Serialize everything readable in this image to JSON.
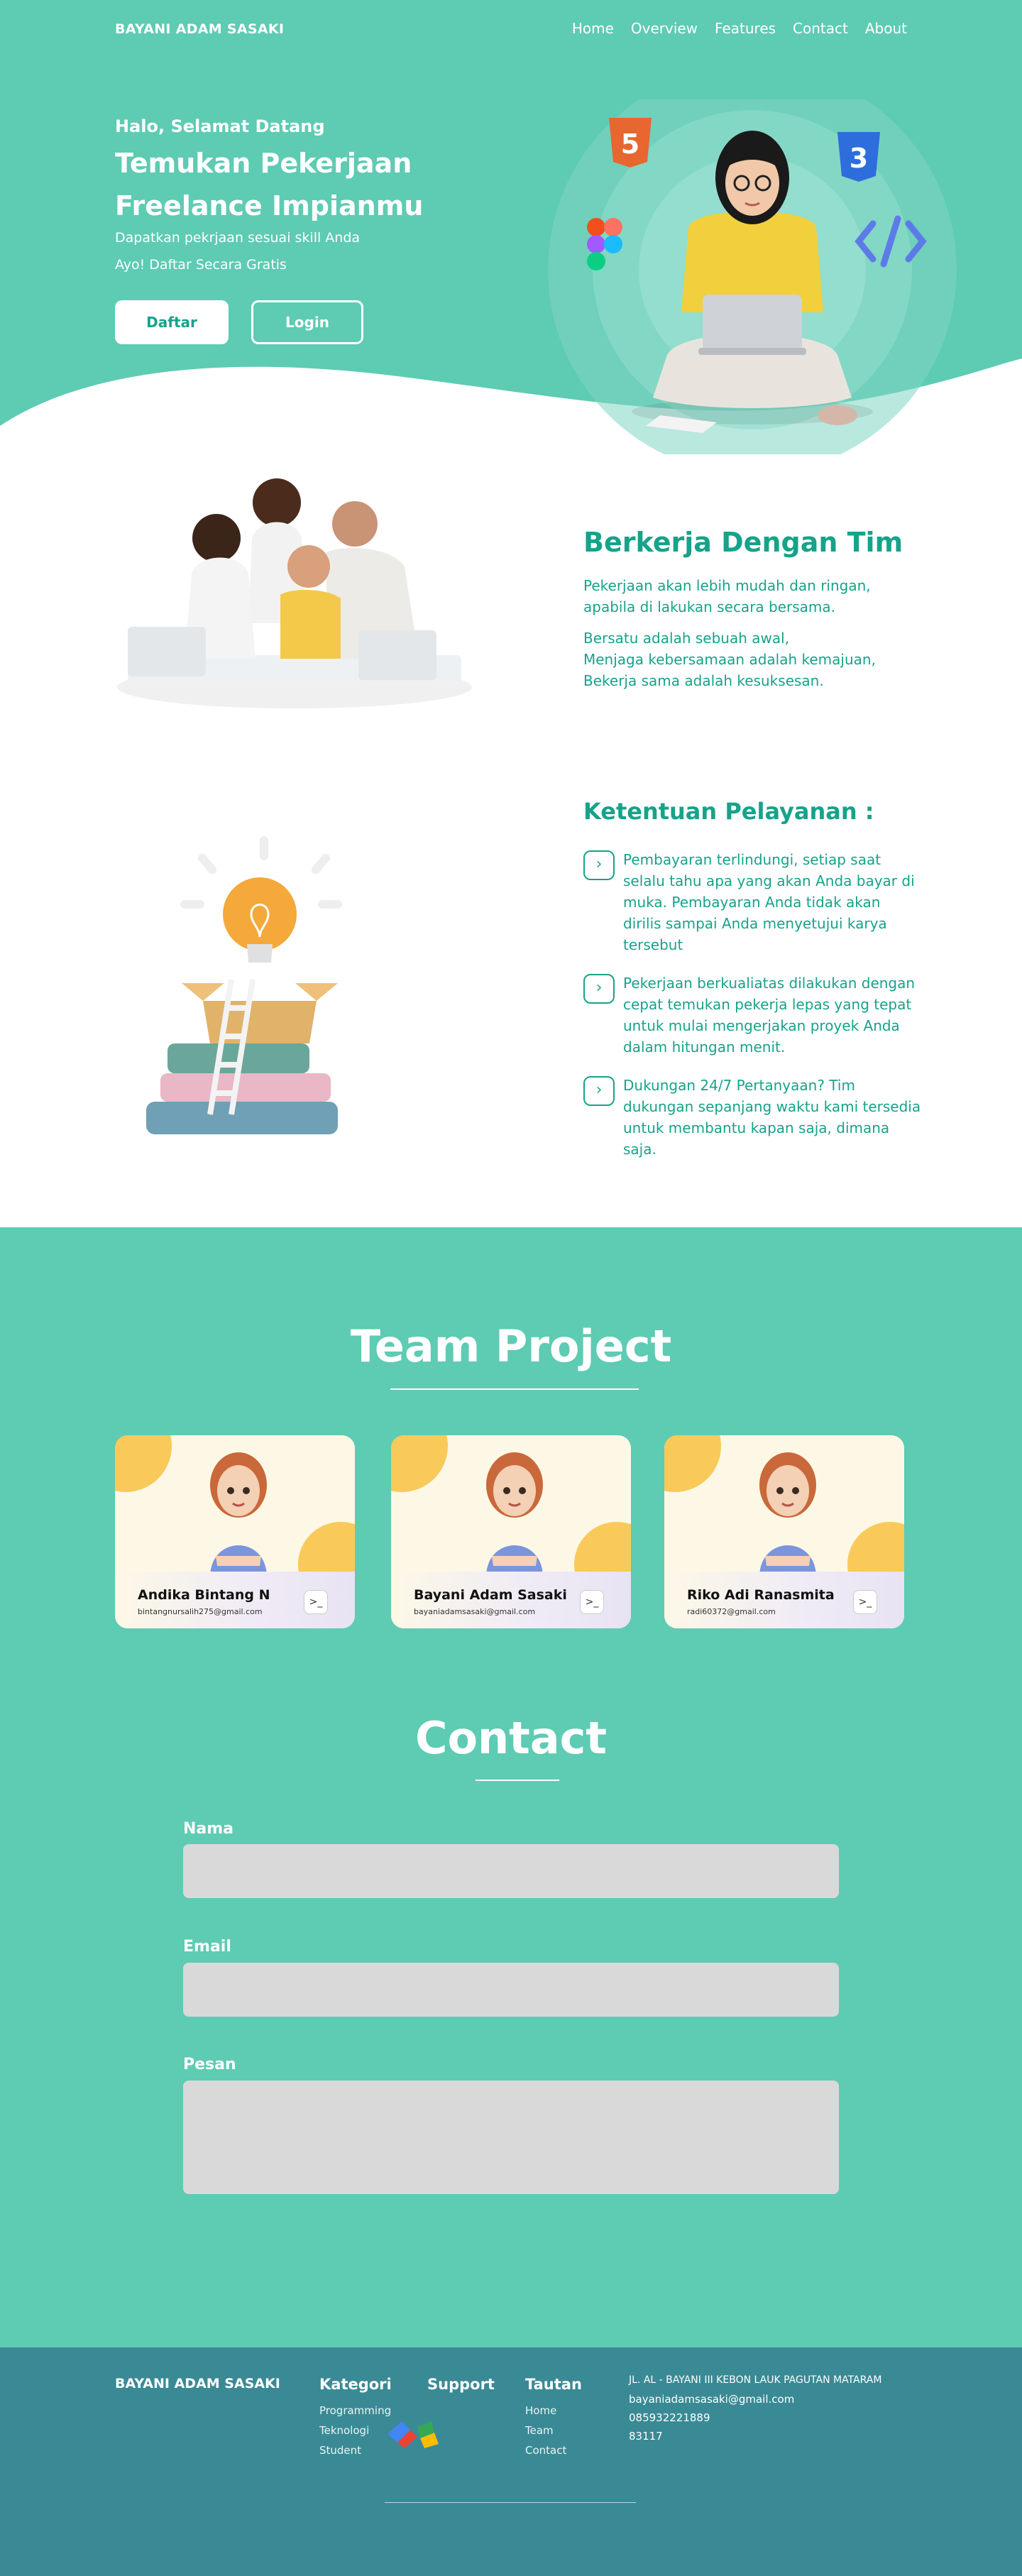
{
  "nav": {
    "brand": "BAYANI ADAM SASAKI",
    "links": [
      "Home",
      "Overview",
      "Features",
      "Contact",
      "About"
    ]
  },
  "hero": {
    "greeting": "Halo, Selamat Datang",
    "title": "Temukan Pekerjaan Freelance Impianmu",
    "subtitle": "Dapatkan pekrjaan sesuai skill Anda",
    "cta_text": "Ayo! Daftar Secara Gratis",
    "register_label": "Daftar",
    "login_label": "Login"
  },
  "teamwork": {
    "title": "Berkerja Dengan Tim",
    "para1_line1": "Pekerjaan akan lebih mudah dan ringan,",
    "para1_line2": "apabila di lakukan secara bersama.",
    "para2_line1": "Bersatu adalah sebuah awal,",
    "para2_line2": "Menjaga kebersamaan adalah kemajuan,",
    "para2_line3": "Bekerja sama adalah kesuksesan."
  },
  "terms": {
    "title": "Ketentuan Pelayanan :",
    "items": [
      "Pembayaran terlindungi, setiap saat selalu tahu apa yang akan Anda bayar di muka. Pembayaran Anda tidak akan dirilis sampai Anda menyetujui karya tersebut",
      "Pekerjaan berkualiatas dilakukan dengan cepat temukan pekerja lepas yang tepat untuk mulai mengerjakan proyek Anda dalam hitungan menit.",
      "Dukungan 24/7 Pertanyaan? Tim dukungan sepanjang waktu kami tersedia untuk membantu kapan saja, dimana saja."
    ]
  },
  "team": {
    "title": "Team Project",
    "members": [
      {
        "name": "Andika Bintang N",
        "email": "bintangnursalih275@gmail.com"
      },
      {
        "name": "Bayani Adam Sasaki",
        "email": "bayaniadamsasaki@gmail.com"
      },
      {
        "name": "Riko Adi Ranasmita",
        "email": "radi60372@gmail.com"
      }
    ]
  },
  "contact": {
    "title": "Contact",
    "name_label": "Nama",
    "email_label": "Email",
    "message_label": "Pesan"
  },
  "footer": {
    "brand": "BAYANI ADAM SASAKI",
    "kategori_title": "Kategori",
    "kategori_items": [
      "Programming",
      "Teknologi",
      "Student"
    ],
    "support_title": "Support",
    "tautan_title": "Tautan",
    "tautan_items": [
      "Home",
      "Team",
      "Contact"
    ],
    "address": "JL. AL - BAYANI III KEBON LAUK PAGUTAN MATARAM",
    "email": "bayaniadamsasaki@gmail.com",
    "phone": "085932221889",
    "postal": "83117"
  },
  "colors": {
    "primary": "#5ecbb3",
    "accent_text": "#16a38a",
    "footer": "#3a8a95",
    "input": "#d9d9d9"
  }
}
